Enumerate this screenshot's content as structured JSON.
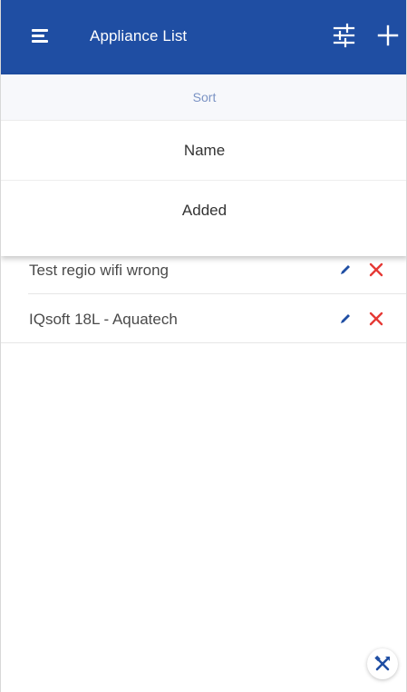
{
  "app": {
    "title": "Appliance List",
    "colors": {
      "appbar": "#1f4ea3",
      "delete": "#e53935",
      "edit": "#1f4ea3",
      "sort_header_text": "#7b93c4"
    }
  },
  "header": {
    "menu_icon": "menu-icon",
    "filter_icon": "sliders-icon",
    "add_icon": "plus-icon"
  },
  "sort_panel": {
    "title": "Sort",
    "options": [
      {
        "label": "Name"
      },
      {
        "label": "Added"
      }
    ]
  },
  "appliances": [
    {
      "name": "Test regio wifi wrong",
      "edit_icon": "pencil-icon",
      "delete_icon": "close-icon"
    },
    {
      "name": "IQsoft 18L - Aquatech",
      "edit_icon": "pencil-icon",
      "delete_icon": "close-icon"
    }
  ],
  "fab": {
    "icon": "tools-icon"
  }
}
